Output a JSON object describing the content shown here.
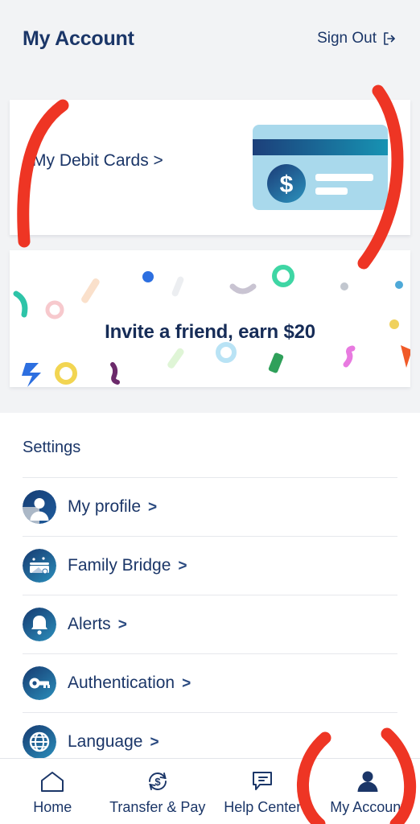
{
  "colors": {
    "page_bg": "#f2f3f5",
    "card_bg": "#ffffff",
    "navy": "#1b3668",
    "annotation_red": "#ee3524",
    "card_light_blue": "#a9d9ec",
    "card_stripe_dark": "#1c3f7a",
    "card_stripe_teal": "#1793b3",
    "icon_gradient_start": "#173d73",
    "icon_gradient_end": "#2a8bb8"
  },
  "header": {
    "title": "My Account",
    "sign_out_label": "Sign Out",
    "sign_out_icon": "exit-icon"
  },
  "debit_panel": {
    "label": "My Debit Cards >",
    "label_text": "My Debit Cards",
    "chevron": ">",
    "art_icon": "debit-card-illustration",
    "card_symbol": "$"
  },
  "invite_banner": {
    "text": "Invite a friend, earn $20",
    "decoration": "confetti"
  },
  "settings": {
    "title": "Settings",
    "items": [
      {
        "label": "My profile",
        "chevron": ">",
        "icon": "person-avatar-icon"
      },
      {
        "label": "Family Bridge",
        "chevron": ">",
        "icon": "family-bridge-icon"
      },
      {
        "label": "Alerts",
        "chevron": ">",
        "icon": "bell-icon"
      },
      {
        "label": "Authentication",
        "chevron": ">",
        "icon": "key-icon"
      },
      {
        "label": "Language",
        "chevron": ">",
        "icon": "globe-icon"
      }
    ]
  },
  "bottom_nav": {
    "items": [
      {
        "label": "Home",
        "icon": "home-icon",
        "active": false
      },
      {
        "label": "Transfer & Pay",
        "icon": "transfer-dollar-icon",
        "active": false
      },
      {
        "label": "Help Center",
        "icon": "chat-bubble-icon",
        "active": false
      },
      {
        "label": "My Account",
        "icon": "person-filled-icon",
        "active": true
      }
    ]
  },
  "annotations": {
    "left_bracket": "red-bracket-left",
    "right_bracket": "red-bracket-right",
    "circle_my_account": "red-circle-my-account"
  }
}
